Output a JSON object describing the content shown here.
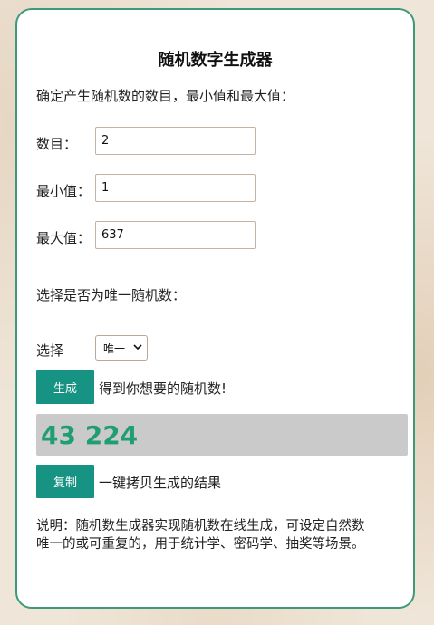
{
  "title": "随机数字生成器",
  "intro": "确定产生随机数的数目，最小值和最大值：",
  "fields": {
    "count": {
      "label": "数目：",
      "value": "2"
    },
    "min": {
      "label": "最小值：",
      "value": "1"
    },
    "max": {
      "label": "最大值：",
      "value": "637"
    }
  },
  "unique": {
    "section_label": "选择是否为唯一随机数：",
    "label": "选择",
    "selected": "唯一"
  },
  "generate": {
    "button": "生成",
    "desc": "得到你想要的随机数!"
  },
  "result": "43 224",
  "copy": {
    "button": "复制",
    "desc": "一键拷贝生成的结果"
  },
  "note_line1": "说明：随机数生成器实现随机数在线生成，可设定自然数",
  "note_line2": "唯一的或可重复的，用于统计学、密码学、抽奖等场景。",
  "colors": {
    "accent": "#179383",
    "border": "#3c9a78",
    "result_text": "#1f9d74"
  }
}
